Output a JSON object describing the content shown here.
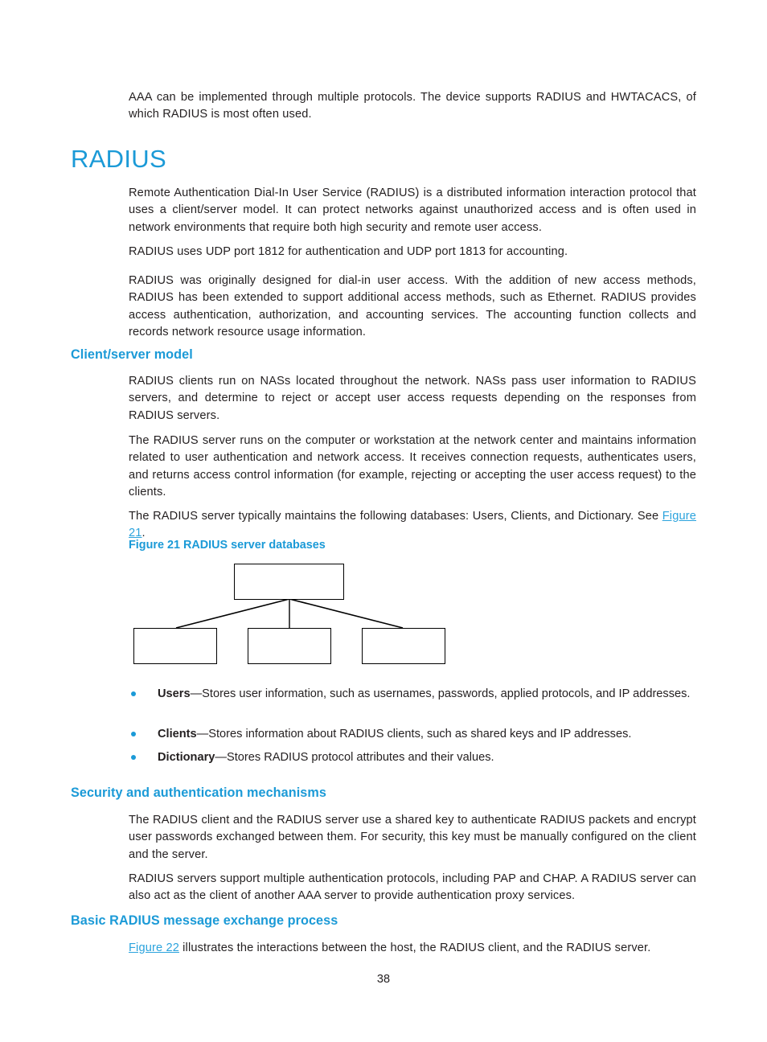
{
  "page": {
    "number": "38",
    "accent_color": "#1b9ad7",
    "text_color": "#231f20"
  },
  "intro": {
    "paragraph": "AAA can be implemented through multiple protocols. The device supports RADIUS and HWTACACS, of which RADIUS is most often used."
  },
  "heading": {
    "title": "RADIUS"
  },
  "overview": {
    "p1": "Remote Authentication Dial-In User Service (RADIUS) is a distributed information interaction protocol that uses a client/server model. It can protect networks against unauthorized access and is often used in network environments that require both high security and remote user access.",
    "p2": "RADIUS uses UDP port 1812 for authentication and UDP port 1813 for accounting.",
    "p3": "RADIUS was originally designed for dial-in user access. With the addition of new access methods, RADIUS has been extended to support additional access methods, such as Ethernet. RADIUS provides access authentication, authorization, and accounting services. The accounting function collects and records network resource usage information."
  },
  "client_server": {
    "heading": "Client/server model",
    "p1": "RADIUS clients run on NASs located throughout the network. NASs pass user information to RADIUS servers, and determine to reject or accept user access requests depending on the responses from RADIUS servers.",
    "p2": "The RADIUS server runs on the computer or workstation at the network center and maintains information related to user authentication and network access. It receives connection requests, authenticates users, and returns access control information (for example, rejecting or accepting the user access request) to the clients.",
    "p3_before": "The RADIUS server typically maintains the following databases: Users, Clients, and Dictionary. See ",
    "p3_link": "Figure 21",
    "p3_after": "."
  },
  "figure21": {
    "caption": "Figure 21 RADIUS server databases",
    "boxes": {
      "root": "",
      "child1": "",
      "child2": "",
      "child3": ""
    }
  },
  "databases": [
    {
      "term": "Users",
      "description": "—Stores user information, such as usernames, passwords, applied protocols, and IP addresses."
    },
    {
      "term": "Clients",
      "description": "—Stores information about RADIUS clients, such as shared keys and IP addresses."
    },
    {
      "term": "Dictionary",
      "description": "—Stores RADIUS protocol attributes and their values."
    }
  ],
  "security": {
    "heading": "Security and authentication mechanisms",
    "p1": "The RADIUS client and the RADIUS server use a shared key to authenticate RADIUS packets and encrypt user passwords exchanged between them. For security, this key must be manually configured on the client and the server.",
    "p2": "RADIUS servers support multiple authentication protocols, including PAP and CHAP. A RADIUS server can also act as the client of another AAA server to provide authentication proxy services."
  },
  "message_exchange": {
    "heading": "Basic RADIUS message exchange process",
    "p1_link": "Figure 22",
    "p1_after": " illustrates the interactions between the host, the RADIUS client, and the RADIUS server."
  }
}
